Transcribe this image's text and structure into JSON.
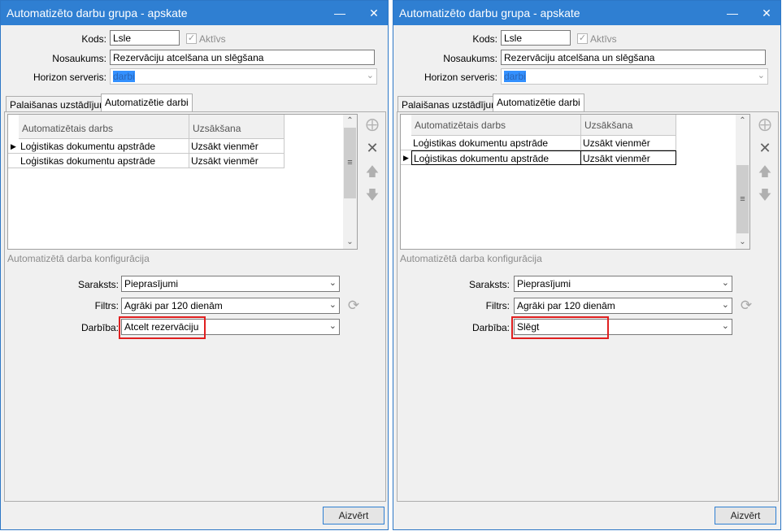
{
  "windows": [
    {
      "title": "Automatizēto darbu grupa - apskate",
      "kods_label": "Kods:",
      "kods_value": "Lsle",
      "aktivs_label": "Aktīvs",
      "nosaukums_label": "Nosaukums:",
      "nosaukums_value": "Rezervāciju atcelšana un slēgšana",
      "horizon_label": "Horizon serveris:",
      "horizon_value": "darbi",
      "tab1": "Palaišanas uzstādījumi",
      "tab2": "Automatizētie darbi",
      "col1": "Automatizētais darbs",
      "col2": "Uzsākšana",
      "rows": [
        {
          "task": "Loģistikas dokumentu apstrāde",
          "start": "Uzsākt vienmēr"
        },
        {
          "task": "Loģistikas dokumentu apstrāde",
          "start": "Uzsākt vienmēr"
        }
      ],
      "config_label": "Automatizētā darba konfigurācija",
      "saraksts_label": "Saraksts:",
      "saraksts_value": "Pieprasījumi",
      "filtrs_label": "Filtrs:",
      "filtrs_value": "Agrāki par 120 dienām",
      "darbiba_label": "Darbība:",
      "darbiba_value": "Atcelt rezervāciju",
      "close_button": "Aizvērt"
    },
    {
      "title": "Automatizēto darbu grupa - apskate",
      "kods_label": "Kods:",
      "kods_value": "Lsle",
      "aktivs_label": "Aktīvs",
      "nosaukums_label": "Nosaukums:",
      "nosaukums_value": "Rezervāciju atcelšana un slēgšana",
      "horizon_label": "Horizon serveris:",
      "horizon_value": "darbi",
      "tab1": "Palaišanas uzstādījumi",
      "tab2": "Automatizētie darbi",
      "col1": "Automatizētais darbs",
      "col2": "Uzsākšana",
      "rows": [
        {
          "task": "Loģistikas dokumentu apstrāde",
          "start": "Uzsākt vienmēr"
        },
        {
          "task": "Loģistikas dokumentu apstrāde",
          "start": "Uzsākt vienmēr"
        }
      ],
      "config_label": "Automatizētā darba konfigurācija",
      "saraksts_label": "Saraksts:",
      "saraksts_value": "Pieprasījumi",
      "filtrs_label": "Filtrs:",
      "filtrs_value": "Agrāki par 120 dienām",
      "darbiba_label": "Darbība:",
      "darbiba_value": "Slēgt",
      "close_button": "Aizvērt"
    }
  ],
  "icons": {
    "minimize": "minimize-icon",
    "close": "close-icon",
    "add": "add-row-icon",
    "delete": "delete-row-icon",
    "up": "move-up-icon",
    "down": "move-down-icon",
    "refresh": "refresh-icon"
  },
  "colors": {
    "titlebar": "#2f7fd2",
    "highlight_box": "#e02020",
    "selection": "#3390ff"
  }
}
